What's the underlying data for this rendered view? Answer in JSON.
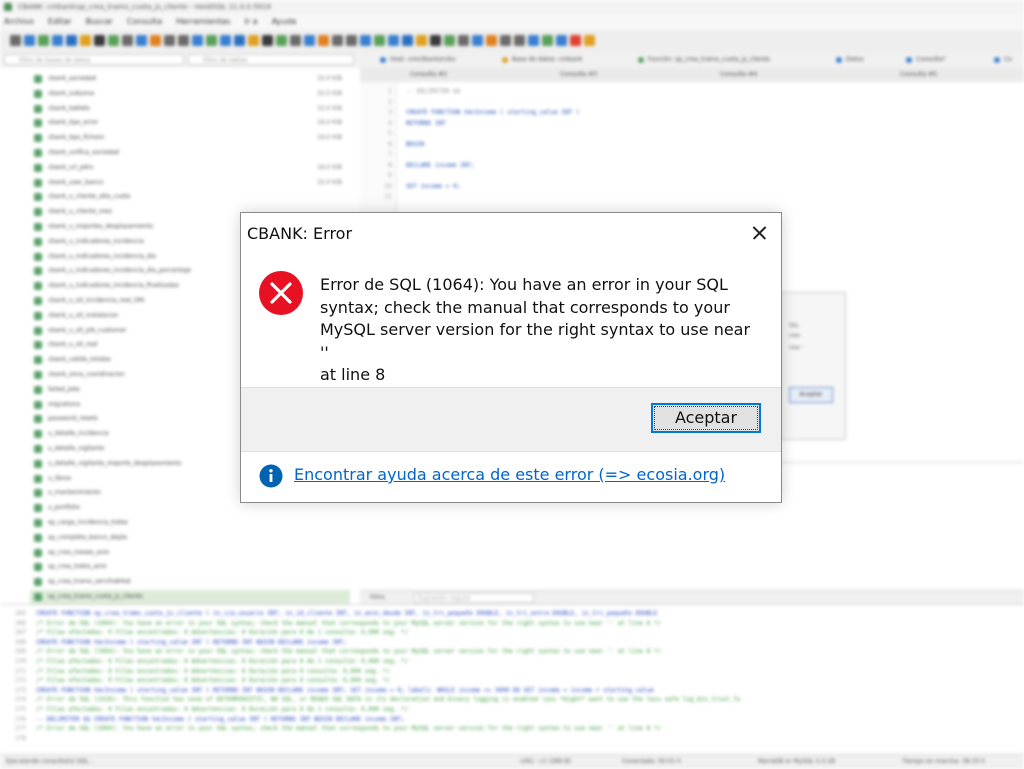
{
  "background_app": {
    "title": "CBANK: cmbank\\sp_crea_tramo_cuota_js_cliente - HeidiSQL 11.0.0.5919",
    "menu": [
      "Archivo",
      "Editar",
      "Buscar",
      "Consulta",
      "Herramientas",
      "Ir a",
      "Ayuda"
    ],
    "filters": {
      "db_placeholder": "Filtro de bases de datos",
      "table_placeholder": "Filtro de tablas"
    },
    "tabs": [
      "Host: cmictbanksrvbu",
      "Base de datos: cmbank",
      "Función: sp_crea_tramo_cuota_js_cliente",
      "Datos",
      "Consulta*",
      "Co"
    ],
    "subtabs": [
      "Consulta #2",
      "Consulta #3",
      "Consulta #4",
      "Consulta #5"
    ],
    "tree": [
      {
        "label": "cbank_sociedad",
        "value": "32,0 KiB"
      },
      {
        "label": "cbank_subzona",
        "value": "32,0 KiB"
      },
      {
        "label": "cbank_tablets",
        "value": "32,0 KiB"
      },
      {
        "label": "cbank_tipo_error",
        "value": "16,0 KiB"
      },
      {
        "label": "cbank_tipo_fichero",
        "value": "16,0 KiB"
      },
      {
        "label": "cbank_unifica_sociedad",
        "value": ""
      },
      {
        "label": "cbank_url_pdrs",
        "value": "16,0 KiB"
      },
      {
        "label": "cbank_user_banco",
        "value": "32,0 KiB"
      },
      {
        "label": "cbank_u_cliente_alta_cuota",
        "value": ""
      },
      {
        "label": "cbank_u_cliente_mes",
        "value": ""
      },
      {
        "label": "cbank_u_importes_desplazamiento",
        "value": ""
      },
      {
        "label": "cbank_u_indicadores_incidencia",
        "value": ""
      },
      {
        "label": "cbank_u_indicadores_incidencia_dia",
        "value": ""
      },
      {
        "label": "cbank_u_indicadores_incidencia_dia_porcentaje",
        "value": ""
      },
      {
        "label": "cbank_u_indicadores_incidencia_finalizadas",
        "value": ""
      },
      {
        "label": "cbank_u_sit_incidencia_real_ORI",
        "value": ""
      },
      {
        "label": "cbank_u_sit_instalacion",
        "value": ""
      },
      {
        "label": "cbank_u_sit_job_customer",
        "value": ""
      },
      {
        "label": "cbank_u_sit_real",
        "value": ""
      },
      {
        "label": "cbank_valida_totales",
        "value": ""
      },
      {
        "label": "cbank_zona_coordinacion",
        "value": ""
      },
      {
        "label": "failed_jobs",
        "value": ""
      },
      {
        "label": "migrations",
        "value": ""
      },
      {
        "label": "password_resets",
        "value": ""
      },
      {
        "label": "u_detalle_incidencia",
        "value": ""
      },
      {
        "label": "u_detalle_vigilante",
        "value": ""
      },
      {
        "label": "u_detalle_vigilante_importe_desplazamiento",
        "value": ""
      },
      {
        "label": "u_libros",
        "value": ""
      },
      {
        "label": "u_mantenimiento",
        "value": ""
      },
      {
        "label": "u_portfolio",
        "value": ""
      },
      {
        "label": "sp_carga_incidencia_todas",
        "value": ""
      },
      {
        "label": "sp_completa_banco_depla",
        "value": ""
      },
      {
        "label": "sp_crea_meses_anio",
        "value": ""
      },
      {
        "label": "sp_crea_todos_anio",
        "value": ""
      },
      {
        "label": "sp_crea_tramo_servihabitat",
        "value": ""
      },
      {
        "label": "sp_crea_tramo_cuota_js_cliente",
        "value": ""
      }
    ],
    "editor": {
      "line_numbers": [
        "1",
        "2",
        "3",
        "4",
        "5",
        "6",
        "7",
        "8",
        "9",
        "10",
        "11"
      ],
      "code": [
        "-- DELIMITER $$",
        "",
        "CREATE FUNCTION tmcIncome ( starting_value INT )",
        "RETURNS INT",
        "",
        "BEGIN",
        "",
        "   DECLARE income INT;",
        "",
        "   SET income = 0;",
        ""
      ]
    },
    "results_filter_label": "Filtro",
    "results_filter_placeholder": "Expresión regular",
    "ghost_dialog": {
      "button": "Aceptar",
      "text_lines": [
        "SQL",
        "ndar",
        "near '"
      ]
    },
    "log": {
      "line_numbers": [
        "265",
        "266",
        "267",
        "268",
        "269",
        "270",
        "271",
        "272",
        "273",
        "274",
        "275",
        "276",
        "277",
        "278"
      ],
      "lines": [
        {
          "kind": "sql",
          "text": "CREATE FUNCTION sp_crea_tramo_cuota_js_cliente (  in_cia_usuario INT,  in_id_cliente INT,  in_anio_desde INT,  in_tri_pequeño DOUBLE,  in_tri_extra DOUBLE,  in_tri_pequeño DOUBLE"
        },
        {
          "kind": "cmt",
          "text": "/* Error de SQL (1064): You have an error in your SQL syntax; check the manual that corresponds to your MySQL server version for the right syntax to use near '' at line 8 */"
        },
        {
          "kind": "cmt",
          "text": "/* Filas afectadas: 0  Filas encontradas: 0  Advertencias: 0  Duración para 0 de 1 consulta: 0,000 seg. */"
        },
        {
          "kind": "sql",
          "text": "CREATE FUNCTION tmcIncome ( starting_value INT )  RETURNS INT   BEGIN    DECLARE income INT;"
        },
        {
          "kind": "cmt",
          "text": "/* Error de SQL (1064): You have an error in your SQL syntax; check the manual that corresponds to your MySQL server version for the right syntax to use near '' at line 8 */"
        },
        {
          "kind": "cmt",
          "text": "/* Filas afectadas: 0  Filas encontradas: 0  Advertencias: 0  Duración para 0 de 1 consulta: 0,000 seg. */"
        },
        {
          "kind": "cmt",
          "text": "/* Filas afectadas: 0  Filas encontradas: 0  Advertencias: 0  Duración para 0 consulta: 0,000 seg. */"
        },
        {
          "kind": "cmt",
          "text": "/* Filas afectadas: 0  Filas encontradas: 0  Advertencias: 0  Duración para 0 consulta: 0,000 seg. */"
        },
        {
          "kind": "sql",
          "text": "CREATE FUNCTION tmcIncome ( starting_value INT )  RETURNS INT   BEGIN    DECLARE income INT;    SET income = 0;   label1: WHILE income <= 3000 DO    SET income = income + starting_value"
        },
        {
          "kind": "cmt",
          "text": "/* Error de SQL (1418): This function has none of DETERMINISTIC, NO SQL, or READS SQL DATA in its declaration and binary logging is enabled (you *might* want to use the less safe log_bin_trust_fu"
        },
        {
          "kind": "cmt",
          "text": "/* Filas afectadas: 0  Filas encontradas: 0  Advertencias: 0  Duración para 0 de 1 consulta: 0,000 seg. */"
        },
        {
          "kind": "sql",
          "text": "-- DELIMITER $$    CREATE FUNCTION tmcIncome ( starting_value INT )  RETURNS INT   BEGIN    DECLARE income INT;"
        },
        {
          "kind": "cmt",
          "text": "/* Error de SQL (1064): You have an error in your SQL syntax; check the manual that corresponds to your MySQL server version for the right syntax to use near '' at line 8 */"
        },
        {
          "kind": "cmt",
          "text": ""
        }
      ]
    },
    "status": {
      "left": "Ejecutando consulta(s) SQL...",
      "pos": "r261 : c1 (289 B)",
      "connected": "Conectado: 00:01 h",
      "server": "MariaDB or MySQL 5.5.28",
      "uptime": "Tiempo en marcha: 38:33 h"
    }
  },
  "dialog": {
    "title": "CBANK: Error",
    "message": "Error de SQL (1064): You have an error in your SQL\nsyntax; check the manual that corresponds to your\nMySQL server version for the right syntax to use near ''\nat line 8",
    "ok_label": "Aceptar",
    "help_link": "Encontrar ayuda acerca de este error (=> ecosia.org)",
    "colors": {
      "error_red": "#e81123",
      "info_blue": "#0063b1",
      "link": "#0066cc",
      "button_focus": "#0078d7"
    }
  }
}
